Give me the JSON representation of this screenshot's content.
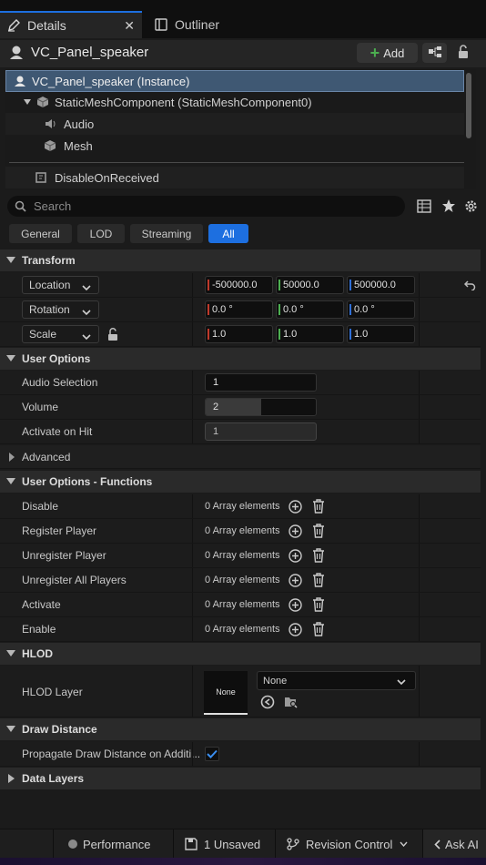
{
  "tabs": {
    "details": "Details",
    "outliner": "Outliner"
  },
  "header": {
    "title": "VC_Panel_speaker",
    "add_label": "Add"
  },
  "tree": {
    "items": [
      {
        "label": "VC_Panel_speaker (Instance)"
      },
      {
        "label": "StaticMeshComponent (StaticMeshComponent0)"
      },
      {
        "label": "Audio"
      },
      {
        "label": "Mesh"
      },
      {
        "label": "DisableOnReceived"
      }
    ]
  },
  "search": {
    "placeholder": "Search"
  },
  "filters": [
    "General",
    "LOD",
    "Streaming",
    "All"
  ],
  "filters_active": "All",
  "transform": {
    "title": "Transform",
    "location": {
      "label": "Location",
      "x": "-500000.0",
      "y": "50000.0",
      "z": "500000.0"
    },
    "rotation": {
      "label": "Rotation",
      "x": "0.0 °",
      "y": "0.0 °",
      "z": "0.0 °"
    },
    "scale": {
      "label": "Scale",
      "x": "1.0",
      "y": "1.0",
      "z": "1.0"
    }
  },
  "user_options": {
    "title": "User Options",
    "audio_selection": {
      "label": "Audio Selection",
      "value": "1"
    },
    "volume": {
      "label": "Volume",
      "value": "2",
      "fill_fraction": 0.5
    },
    "activate_on_hit": {
      "label": "Activate on Hit",
      "value": "1"
    }
  },
  "advanced": {
    "title": "Advanced"
  },
  "functions": {
    "title": "User Options - Functions",
    "rows": [
      {
        "label": "Disable",
        "value": "0 Array elements"
      },
      {
        "label": "Register Player",
        "value": "0 Array elements"
      },
      {
        "label": "Unregister Player",
        "value": "0 Array elements"
      },
      {
        "label": "Unregister All Players",
        "value": "0 Array elements"
      },
      {
        "label": "Activate",
        "value": "0 Array elements"
      },
      {
        "label": "Enable",
        "value": "0 Array elements"
      }
    ]
  },
  "hlod": {
    "title": "HLOD",
    "layer_label": "HLOD Layer",
    "thumb_text": "None",
    "dropdown_value": "None"
  },
  "draw_distance": {
    "title": "Draw Distance",
    "propagate_label": "Propagate Draw Distance on Additi...",
    "propagate_checked": true
  },
  "data_layers": {
    "title": "Data Layers"
  },
  "statusbar": {
    "performance": "Performance",
    "unsaved": "1 Unsaved",
    "revision": "Revision Control",
    "ask_ai": "Ask AI"
  },
  "colors": {
    "accent": "#1d6fe0",
    "selection": "#3f5873",
    "x_axis": "#c0392b",
    "y_axis": "#4caf50",
    "z_axis": "#2f6fd6",
    "add_icon": "#4caf50"
  }
}
